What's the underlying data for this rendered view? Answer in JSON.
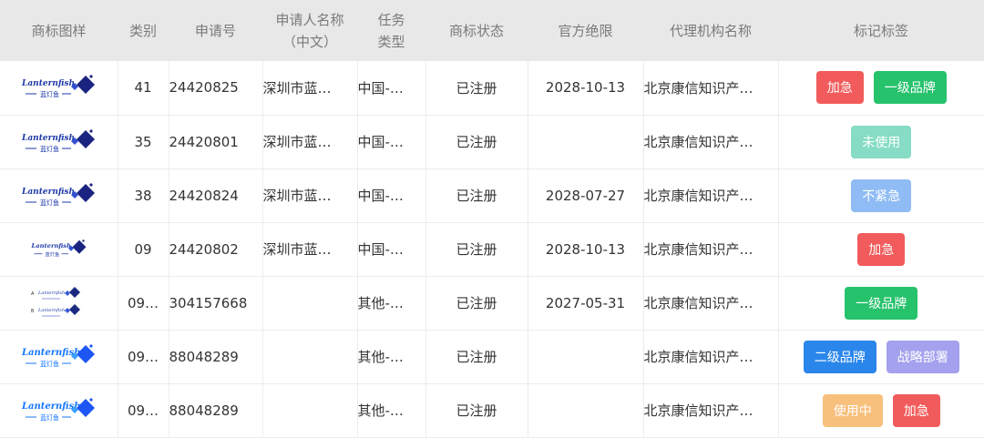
{
  "columns": [
    "商标图样",
    "类别",
    "申请号",
    "申请人名称（中文）",
    "任务类型",
    "商标状态",
    "官方绝限",
    "代理机构名称",
    "标记标签"
  ],
  "logo_text": {
    "latin": "Lanternfish",
    "chinese": "蓝灯鱼"
  },
  "tag_colors": {
    "加急": "#f25b5b",
    "一级品牌": "#27c26c",
    "未使用": "#86dcc4",
    "不紧急": "#8fbcf4",
    "二级品牌": "#2b86eb",
    "战略部署": "#a4a1ee",
    "使用中": "#f8c07d"
  },
  "rows": [
    {
      "logo_variant": "a",
      "category": "41",
      "app_no": "24420825",
      "applicant": "深圳市蓝…",
      "task_type": "中国-…",
      "status": "已注册",
      "deadline": "2028-10-13",
      "agency": "北京康信知识产…",
      "tags": [
        "加急",
        "一级品牌"
      ]
    },
    {
      "logo_variant": "a",
      "category": "35",
      "app_no": "24420801",
      "applicant": "深圳市蓝…",
      "task_type": "中国-…",
      "status": "已注册",
      "deadline": "",
      "agency": "北京康信知识产…",
      "tags": [
        "未使用"
      ]
    },
    {
      "logo_variant": "a",
      "category": "38",
      "app_no": "24420824",
      "applicant": "深圳市蓝…",
      "task_type": "中国-…",
      "status": "已注册",
      "deadline": "2028-07-27",
      "agency": "北京康信知识产…",
      "tags": [
        "不紧急"
      ]
    },
    {
      "logo_variant": "small",
      "category": "09",
      "app_no": "24420802",
      "applicant": "深圳市蓝…",
      "task_type": "中国-…",
      "status": "已注册",
      "deadline": "2028-10-13",
      "agency": "北京康信知识产…",
      "tags": [
        "加急"
      ]
    },
    {
      "logo_variant": "double",
      "category": "09…",
      "app_no": "304157668",
      "applicant": "",
      "task_type": "其他-…",
      "status": "已注册",
      "deadline": "2027-05-31",
      "agency": "北京康信知识产…",
      "tags": [
        "一级品牌"
      ],
      "logo_marks": [
        "A",
        "B"
      ]
    },
    {
      "logo_variant": "blue",
      "category": "09…",
      "app_no": "88048289",
      "applicant": "",
      "task_type": "其他-…",
      "status": "已注册",
      "deadline": "",
      "agency": "北京康信知识产…",
      "tags": [
        "二级品牌",
        "战略部署"
      ]
    },
    {
      "logo_variant": "blue",
      "category": "09…",
      "app_no": "88048289",
      "applicant": "",
      "task_type": "其他-…",
      "status": "已注册",
      "deadline": "",
      "agency": "北京康信知识产…",
      "tags": [
        "使用中",
        "加急"
      ]
    }
  ]
}
